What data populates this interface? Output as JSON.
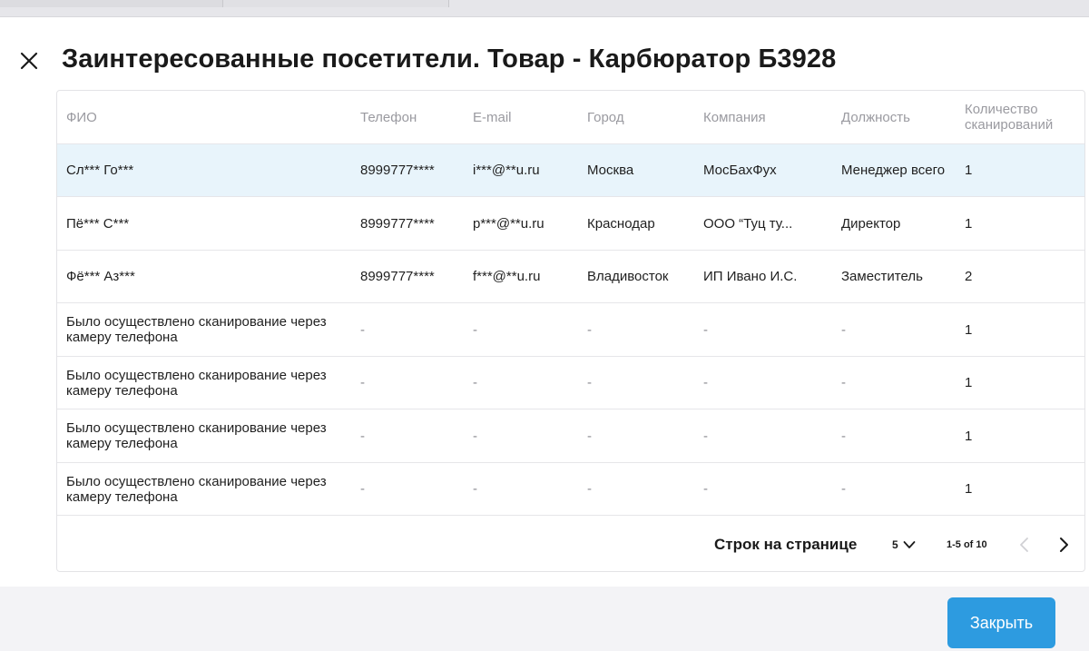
{
  "dialog": {
    "title": "Заинтересованные посетители. Товар -  Карбюратор Б3928",
    "close_icon": "close-icon"
  },
  "table": {
    "columns": [
      {
        "key": "fio",
        "label": "ФИО"
      },
      {
        "key": "phone",
        "label": "Телефон"
      },
      {
        "key": "email",
        "label": "E-mail"
      },
      {
        "key": "city",
        "label": "Город"
      },
      {
        "key": "company",
        "label": "Компания"
      },
      {
        "key": "position",
        "label": "Должность"
      },
      {
        "key": "scans",
        "label": "Количество сканирований"
      }
    ],
    "rows": [
      {
        "fio": "Сл*** Го***",
        "phone": "8999777****",
        "email": "i***@**u.ru",
        "city": "Москва",
        "company": "МосБахФух",
        "position": "Менеджер всего",
        "scans": "1",
        "selected": true
      },
      {
        "fio": "Пё*** С***",
        "phone": "8999777****",
        "email": "p***@**u.ru",
        "city": "Краснодар",
        "company": "ООО “Туц ту...",
        "position": "Директор",
        "scans": "1"
      },
      {
        "fio": "Фё*** Аз***",
        "phone": "8999777****",
        "email": "f***@**u.ru",
        "city": "Владивосток",
        "company": "ИП Ивано И.С.",
        "position": "Заместитель",
        "scans": "2"
      },
      {
        "fio": "Было осуществлено сканирование через камеру телефона",
        "phone": "-",
        "email": "-",
        "city": "-",
        "company": "-",
        "position": "-",
        "scans": "1"
      },
      {
        "fio": "Было осуществлено сканирование через камеру телефона",
        "phone": "-",
        "email": "-",
        "city": "-",
        "company": "-",
        "position": "-",
        "scans": "1"
      },
      {
        "fio": "Было осуществлено сканирование через камеру телефона",
        "phone": "-",
        "email": "-",
        "city": "-",
        "company": "-",
        "position": "-",
        "scans": "1"
      },
      {
        "fio": "Было осуществлено сканирование через камеру телефона",
        "phone": "-",
        "email": "-",
        "city": "-",
        "company": "-",
        "position": "-",
        "scans": "1"
      }
    ]
  },
  "pagination": {
    "rows_per_page_label": "Строк на странице",
    "rows_per_page_value": "5",
    "range_text": "1-5 of 10",
    "prev_icon": "chevron-left-icon",
    "next_icon": "chevron-right-icon"
  },
  "footer": {
    "close_button_label": "Закрыть"
  },
  "colors": {
    "accent": "#2d9be0",
    "selected_row": "#e8f4fb",
    "header_text": "#9a9aa0"
  }
}
